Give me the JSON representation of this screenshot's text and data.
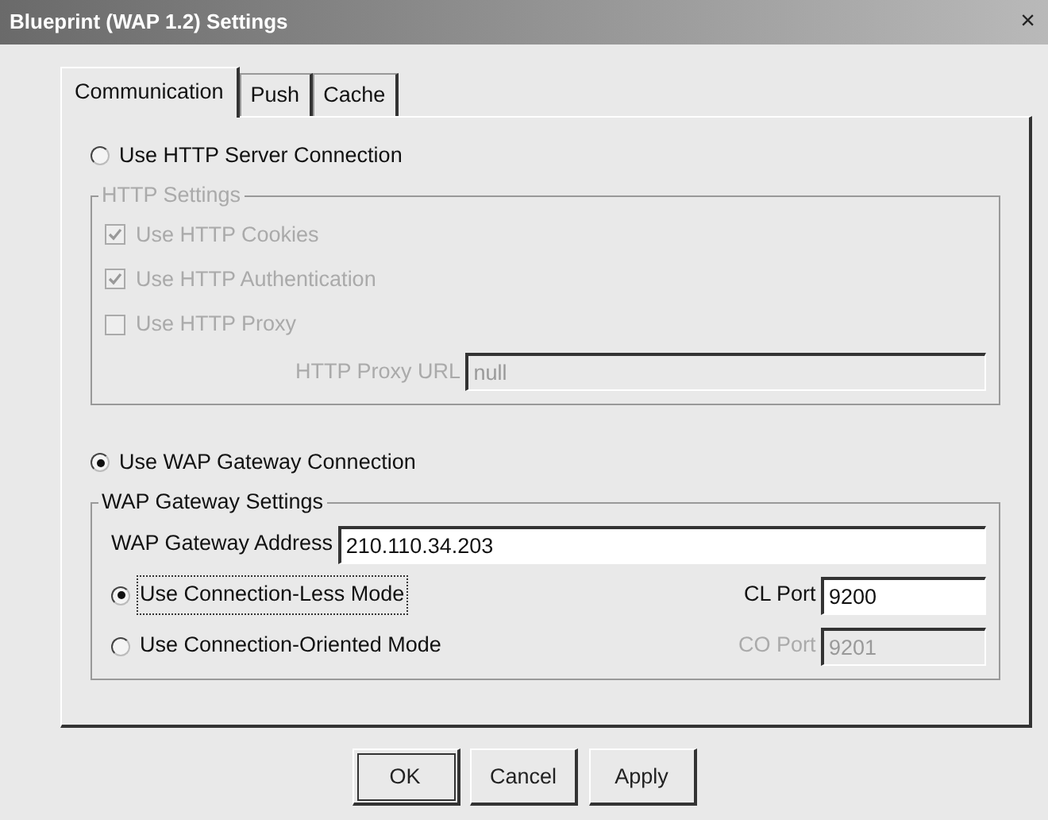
{
  "window": {
    "title": "Blueprint (WAP 1.2) Settings",
    "close": "×"
  },
  "tabs": [
    {
      "label": "Communication",
      "selected": true
    },
    {
      "label": "Push",
      "selected": false
    },
    {
      "label": "Cache",
      "selected": false
    }
  ],
  "connections": [
    {
      "label": "Use HTTP Server Connection",
      "selected": false,
      "group": {
        "title": "HTTP Settings",
        "disabled": true,
        "checkboxes": [
          {
            "label": "Use HTTP Cookies",
            "checked": true
          },
          {
            "label": "Use HTTP Authentication",
            "checked": true
          },
          {
            "label": "Use HTTP Proxy",
            "checked": false
          }
        ],
        "field": {
          "label": "HTTP Proxy URL",
          "value": "null"
        }
      }
    },
    {
      "label": "Use WAP Gateway Connection",
      "selected": true,
      "group": {
        "title": "WAP Gateway Settings",
        "disabled": false,
        "field": {
          "label": "WAP Gateway Address",
          "value": "210.110.34.203"
        },
        "modes": [
          {
            "label": "Use Connection-Less Mode",
            "selected": true,
            "focused": true,
            "port_label": "CL Port",
            "port_value": "9200",
            "port_disabled": false
          },
          {
            "label": "Use Connection-Oriented Mode",
            "selected": false,
            "focused": false,
            "port_label": "CO Port",
            "port_value": "9201",
            "port_disabled": true
          }
        ]
      }
    }
  ],
  "buttons": [
    "OK",
    "Cancel",
    "Apply"
  ]
}
